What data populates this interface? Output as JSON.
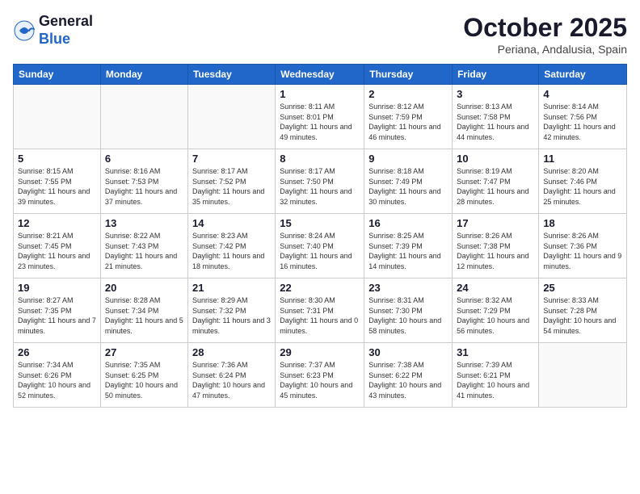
{
  "logo": {
    "general": "General",
    "blue": "Blue"
  },
  "header": {
    "month_year": "October 2025",
    "location": "Periana, Andalusia, Spain"
  },
  "days_of_week": [
    "Sunday",
    "Monday",
    "Tuesday",
    "Wednesday",
    "Thursday",
    "Friday",
    "Saturday"
  ],
  "weeks": [
    [
      {
        "day": "",
        "info": ""
      },
      {
        "day": "",
        "info": ""
      },
      {
        "day": "",
        "info": ""
      },
      {
        "day": "1",
        "info": "Sunrise: 8:11 AM\nSunset: 8:01 PM\nDaylight: 11 hours and 49 minutes."
      },
      {
        "day": "2",
        "info": "Sunrise: 8:12 AM\nSunset: 7:59 PM\nDaylight: 11 hours and 46 minutes."
      },
      {
        "day": "3",
        "info": "Sunrise: 8:13 AM\nSunset: 7:58 PM\nDaylight: 11 hours and 44 minutes."
      },
      {
        "day": "4",
        "info": "Sunrise: 8:14 AM\nSunset: 7:56 PM\nDaylight: 11 hours and 42 minutes."
      }
    ],
    [
      {
        "day": "5",
        "info": "Sunrise: 8:15 AM\nSunset: 7:55 PM\nDaylight: 11 hours and 39 minutes."
      },
      {
        "day": "6",
        "info": "Sunrise: 8:16 AM\nSunset: 7:53 PM\nDaylight: 11 hours and 37 minutes."
      },
      {
        "day": "7",
        "info": "Sunrise: 8:17 AM\nSunset: 7:52 PM\nDaylight: 11 hours and 35 minutes."
      },
      {
        "day": "8",
        "info": "Sunrise: 8:17 AM\nSunset: 7:50 PM\nDaylight: 11 hours and 32 minutes."
      },
      {
        "day": "9",
        "info": "Sunrise: 8:18 AM\nSunset: 7:49 PM\nDaylight: 11 hours and 30 minutes."
      },
      {
        "day": "10",
        "info": "Sunrise: 8:19 AM\nSunset: 7:47 PM\nDaylight: 11 hours and 28 minutes."
      },
      {
        "day": "11",
        "info": "Sunrise: 8:20 AM\nSunset: 7:46 PM\nDaylight: 11 hours and 25 minutes."
      }
    ],
    [
      {
        "day": "12",
        "info": "Sunrise: 8:21 AM\nSunset: 7:45 PM\nDaylight: 11 hours and 23 minutes."
      },
      {
        "day": "13",
        "info": "Sunrise: 8:22 AM\nSunset: 7:43 PM\nDaylight: 11 hours and 21 minutes."
      },
      {
        "day": "14",
        "info": "Sunrise: 8:23 AM\nSunset: 7:42 PM\nDaylight: 11 hours and 18 minutes."
      },
      {
        "day": "15",
        "info": "Sunrise: 8:24 AM\nSunset: 7:40 PM\nDaylight: 11 hours and 16 minutes."
      },
      {
        "day": "16",
        "info": "Sunrise: 8:25 AM\nSunset: 7:39 PM\nDaylight: 11 hours and 14 minutes."
      },
      {
        "day": "17",
        "info": "Sunrise: 8:26 AM\nSunset: 7:38 PM\nDaylight: 11 hours and 12 minutes."
      },
      {
        "day": "18",
        "info": "Sunrise: 8:26 AM\nSunset: 7:36 PM\nDaylight: 11 hours and 9 minutes."
      }
    ],
    [
      {
        "day": "19",
        "info": "Sunrise: 8:27 AM\nSunset: 7:35 PM\nDaylight: 11 hours and 7 minutes."
      },
      {
        "day": "20",
        "info": "Sunrise: 8:28 AM\nSunset: 7:34 PM\nDaylight: 11 hours and 5 minutes."
      },
      {
        "day": "21",
        "info": "Sunrise: 8:29 AM\nSunset: 7:32 PM\nDaylight: 11 hours and 3 minutes."
      },
      {
        "day": "22",
        "info": "Sunrise: 8:30 AM\nSunset: 7:31 PM\nDaylight: 11 hours and 0 minutes."
      },
      {
        "day": "23",
        "info": "Sunrise: 8:31 AM\nSunset: 7:30 PM\nDaylight: 10 hours and 58 minutes."
      },
      {
        "day": "24",
        "info": "Sunrise: 8:32 AM\nSunset: 7:29 PM\nDaylight: 10 hours and 56 minutes."
      },
      {
        "day": "25",
        "info": "Sunrise: 8:33 AM\nSunset: 7:28 PM\nDaylight: 10 hours and 54 minutes."
      }
    ],
    [
      {
        "day": "26",
        "info": "Sunrise: 7:34 AM\nSunset: 6:26 PM\nDaylight: 10 hours and 52 minutes."
      },
      {
        "day": "27",
        "info": "Sunrise: 7:35 AM\nSunset: 6:25 PM\nDaylight: 10 hours and 50 minutes."
      },
      {
        "day": "28",
        "info": "Sunrise: 7:36 AM\nSunset: 6:24 PM\nDaylight: 10 hours and 47 minutes."
      },
      {
        "day": "29",
        "info": "Sunrise: 7:37 AM\nSunset: 6:23 PM\nDaylight: 10 hours and 45 minutes."
      },
      {
        "day": "30",
        "info": "Sunrise: 7:38 AM\nSunset: 6:22 PM\nDaylight: 10 hours and 43 minutes."
      },
      {
        "day": "31",
        "info": "Sunrise: 7:39 AM\nSunset: 6:21 PM\nDaylight: 10 hours and 41 minutes."
      },
      {
        "day": "",
        "info": ""
      }
    ]
  ]
}
